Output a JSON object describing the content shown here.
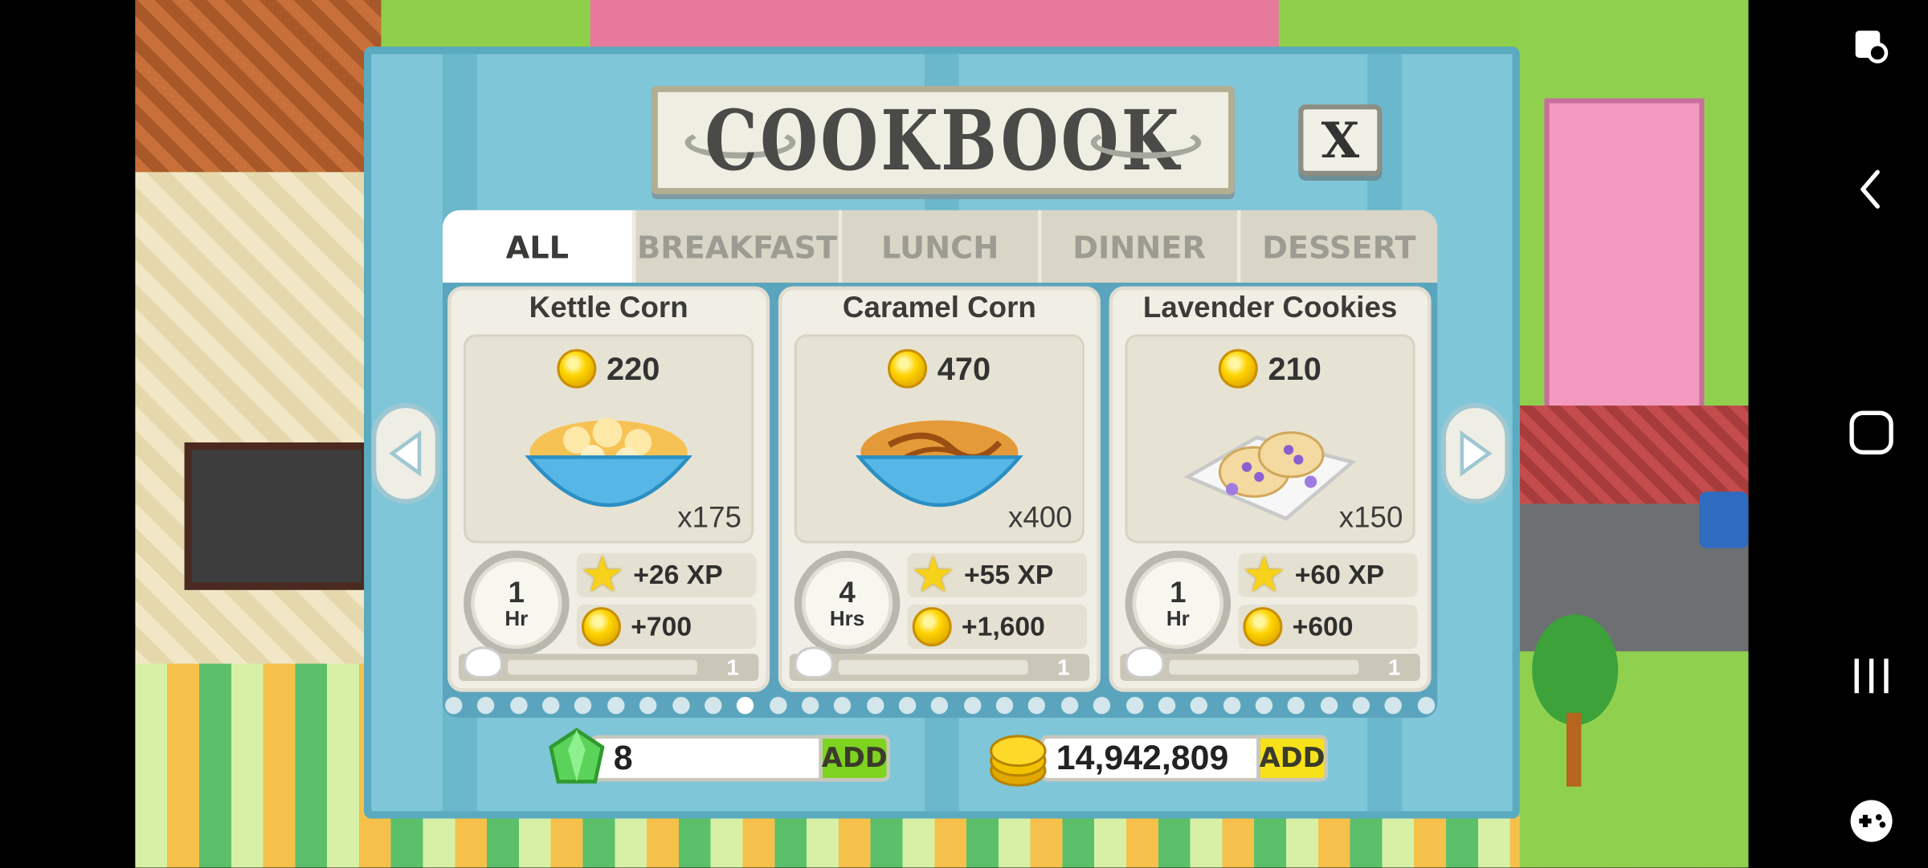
{
  "title": "COOKBOOK",
  "close_label": "X",
  "tabs": [
    {
      "label": "ALL",
      "active": true
    },
    {
      "label": "BREAKFAST",
      "active": false
    },
    {
      "label": "LUNCH",
      "active": false
    },
    {
      "label": "DINNER",
      "active": false
    },
    {
      "label": "DESSERT",
      "active": false
    }
  ],
  "recipes": [
    {
      "name": "Kettle Corn",
      "cost": "220",
      "quantity": "x175",
      "time_value": "1",
      "time_unit": "Hr",
      "xp": "+26 XP",
      "coins": "+700",
      "level": "1",
      "dish_color": "#f6c253",
      "icon": "kettle-corn-bowl"
    },
    {
      "name": "Caramel Corn",
      "cost": "470",
      "quantity": "x400",
      "time_value": "4",
      "time_unit": "Hrs",
      "xp": "+55 XP",
      "coins": "+1,600",
      "level": "1",
      "dish_color": "#e59a39",
      "icon": "caramel-corn-bowl"
    },
    {
      "name": "Lavender Cookies",
      "cost": "210",
      "quantity": "x150",
      "time_value": "1",
      "time_unit": "Hr",
      "xp": "+60 XP",
      "coins": "+600",
      "level": "1",
      "dish_color": "#8a5fd0",
      "icon": "lavender-cookies-plate"
    }
  ],
  "pagination": {
    "total_pages": 31,
    "current_page": 10
  },
  "gems": {
    "value": "8",
    "add_label": "ADD"
  },
  "coins": {
    "value": "14,942,809",
    "add_label": "ADD"
  },
  "colors": {
    "dialog": "#7fc6d8",
    "gem_add": "#7ed321",
    "coin_add": "#f7e11b"
  },
  "nav_icons": [
    "accessibility-icon",
    "back-icon",
    "home-icon",
    "recents-icon",
    "game-controller-icon"
  ]
}
